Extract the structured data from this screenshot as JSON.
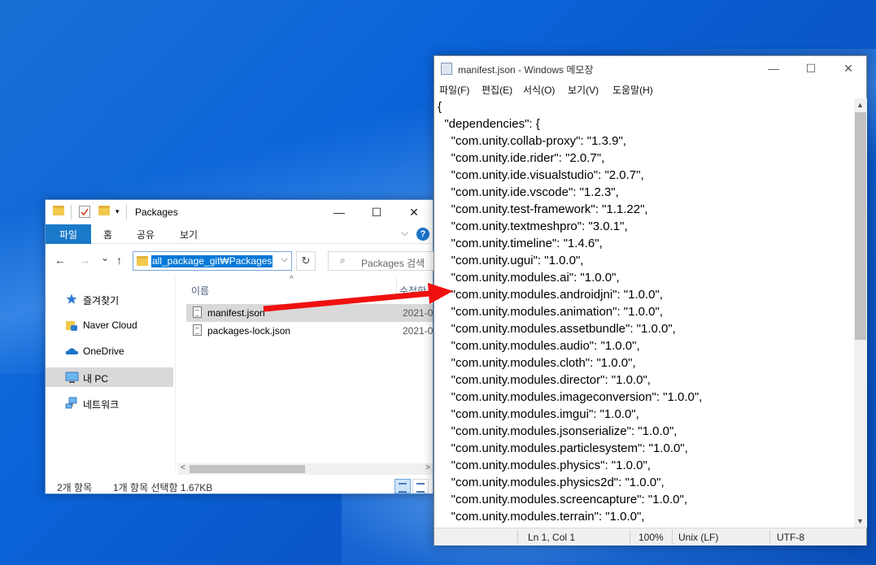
{
  "explorer": {
    "title": "Packages",
    "quick_access_icons": [
      "folder-icon",
      "properties-icon",
      "new-folder-icon",
      "customize-dropdown-icon"
    ],
    "window_controls": {
      "minimize": "—",
      "maximize": "☐",
      "close": "✕"
    },
    "ribbon": {
      "file": "파일",
      "home": "홈",
      "share": "공유",
      "view": "보기",
      "expand": "⌵",
      "help": "?"
    },
    "nav": {
      "back": "←",
      "forward": "→",
      "recent": "⌄",
      "up": "↑",
      "refresh": "↻"
    },
    "address": {
      "path": "all_package_git₩Packages",
      "dropdown": "⌵"
    },
    "search": {
      "placeholder": "Packages 검색",
      "icon": "⌕"
    },
    "sidebar": [
      {
        "label": "즐겨찾기",
        "icon": "star-icon"
      },
      {
        "label": "Naver Cloud",
        "icon": "naver-cloud-icon"
      },
      {
        "label": "OneDrive",
        "icon": "onedrive-icon"
      },
      {
        "label": "내 PC",
        "icon": "computer-icon",
        "selected": true
      },
      {
        "label": "네트워크",
        "icon": "network-icon"
      }
    ],
    "columns": {
      "name": "이름",
      "date": "수정한",
      "sort": "^"
    },
    "files": [
      {
        "name": "manifest.json",
        "date": "2021-0",
        "selected": true
      },
      {
        "name": "packages-lock.json",
        "date": "2021-0",
        "selected": false
      }
    ],
    "scroll": {
      "left": "<",
      "right": ">"
    },
    "status": {
      "count": "2개 항목",
      "selection": "1개 항목 선택함 1.67KB"
    }
  },
  "notepad": {
    "title": "manifest.json - Windows 메모장",
    "window_controls": {
      "minimize": "—",
      "maximize": "☐",
      "close": "✕"
    },
    "menu": [
      "파일(F)",
      "편집(E)",
      "서식(O)",
      "보기(V)",
      "도움말(H)"
    ],
    "lines": [
      "{",
      "  \"dependencies\": {",
      "    \"com.unity.collab-proxy\": \"1.3.9\",",
      "    \"com.unity.ide.rider\": \"2.0.7\",",
      "    \"com.unity.ide.visualstudio\": \"2.0.7\",",
      "    \"com.unity.ide.vscode\": \"1.2.3\",",
      "    \"com.unity.test-framework\": \"1.1.22\",",
      "    \"com.unity.textmeshpro\": \"3.0.1\",",
      "    \"com.unity.timeline\": \"1.4.6\",",
      "    \"com.unity.ugui\": \"1.0.0\",",
      "    \"com.unity.modules.ai\": \"1.0.0\",",
      "    \"com.unity.modules.androidjni\": \"1.0.0\",",
      "    \"com.unity.modules.animation\": \"1.0.0\",",
      "    \"com.unity.modules.assetbundle\": \"1.0.0\",",
      "    \"com.unity.modules.audio\": \"1.0.0\",",
      "    \"com.unity.modules.cloth\": \"1.0.0\",",
      "    \"com.unity.modules.director\": \"1.0.0\",",
      "    \"com.unity.modules.imageconversion\": \"1.0.0\",",
      "    \"com.unity.modules.imgui\": \"1.0.0\",",
      "    \"com.unity.modules.jsonserialize\": \"1.0.0\",",
      "    \"com.unity.modules.particlesystem\": \"1.0.0\",",
      "    \"com.unity.modules.physics\": \"1.0.0\",",
      "    \"com.unity.modules.physics2d\": \"1.0.0\",",
      "    \"com.unity.modules.screencapture\": \"1.0.0\",",
      "    \"com.unity.modules.terrain\": \"1.0.0\","
    ],
    "scroll": {
      "up": "▲",
      "down": "▼"
    },
    "status": {
      "position": "Ln 1, Col 1",
      "zoom": "100%",
      "eol": "Unix (LF)",
      "encoding": "UTF-8"
    }
  },
  "annotation": {
    "arrow_color": "#f01010"
  }
}
